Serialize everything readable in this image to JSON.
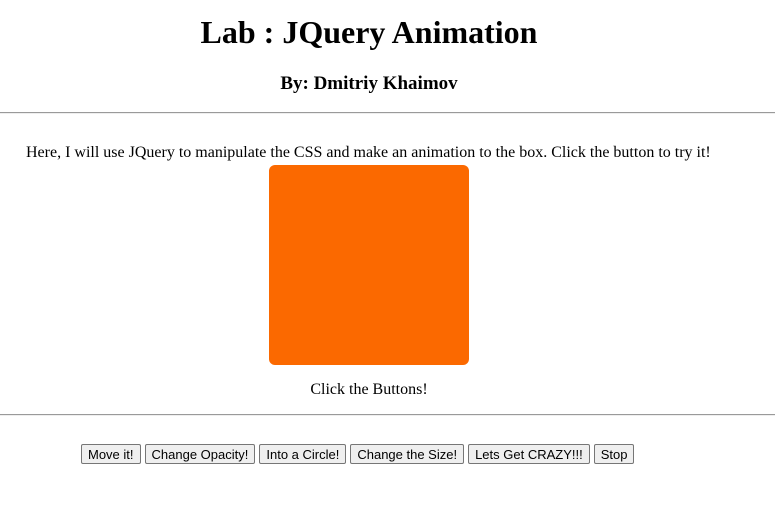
{
  "header": {
    "title": "Lab : JQuery Animation",
    "author": "By: Dmitriy Khaimov"
  },
  "main": {
    "intro": "Here, I will use JQuery to manipulate the CSS and make an animation to the box. Click the button to try it!",
    "box_color": "#fb6900",
    "caption": "Click the Buttons!"
  },
  "controls": {
    "buttons": [
      {
        "label": "Move it!"
      },
      {
        "label": "Change Opacity!"
      },
      {
        "label": "Into a Circle!"
      },
      {
        "label": "Change the Size!"
      },
      {
        "label": "Lets Get CRAZY!!!"
      },
      {
        "label": "Stop"
      }
    ]
  }
}
